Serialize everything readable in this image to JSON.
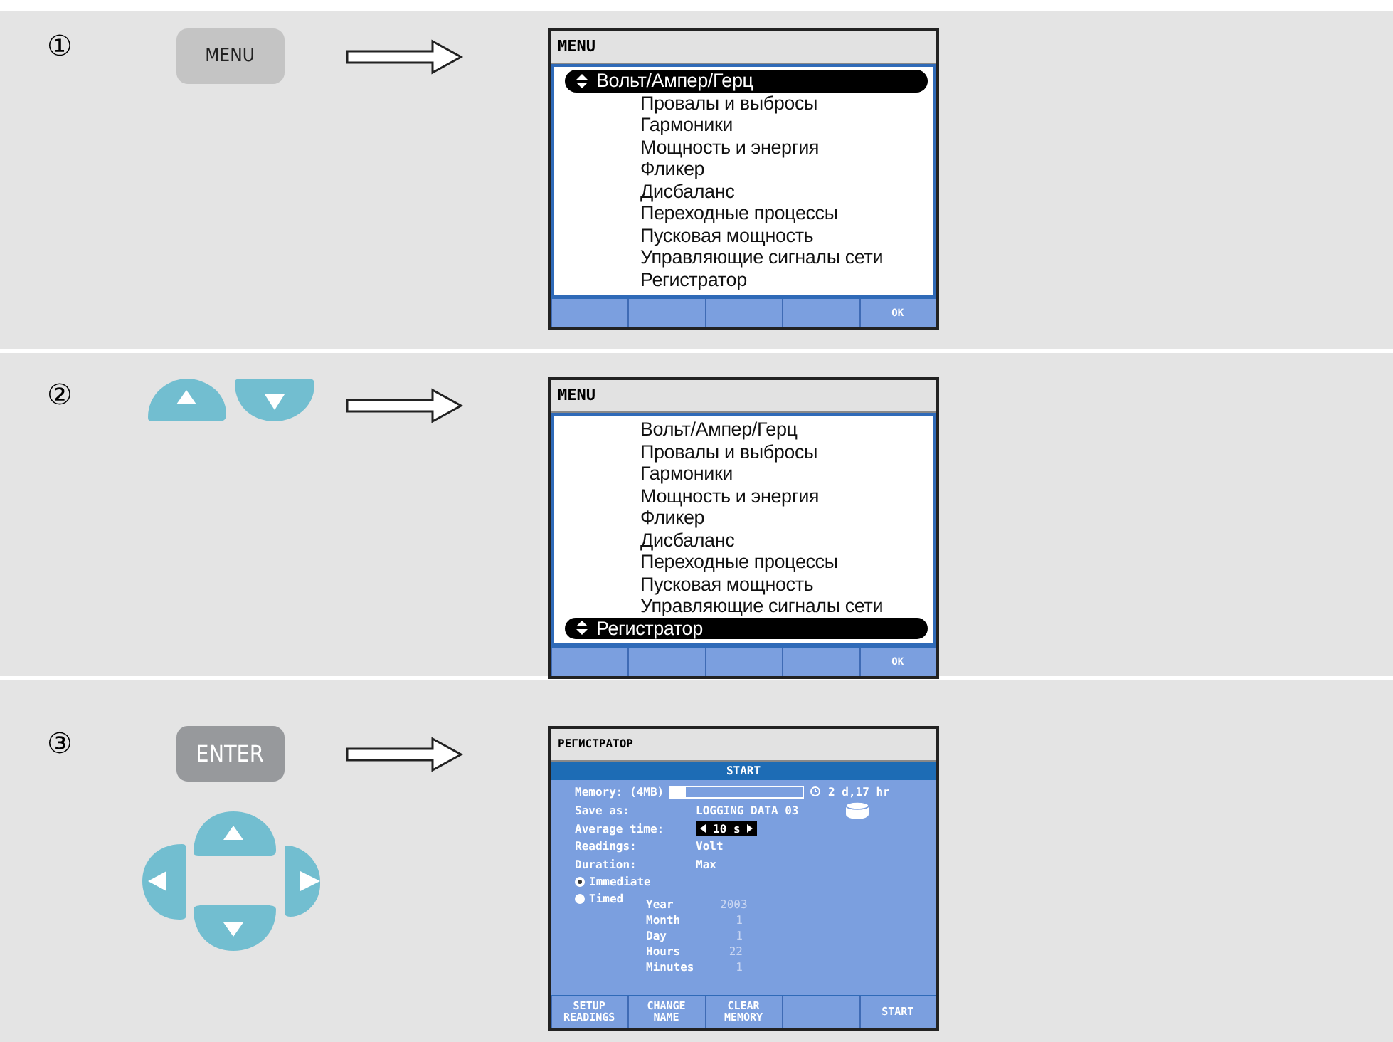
{
  "steps": [
    {
      "number": "①",
      "keys": [
        {
          "kind": "menu",
          "label": "MENU"
        }
      ],
      "screen": {
        "kind": "menu",
        "title": "MENU",
        "items": [
          {
            "label": "Вольт/Ампер/Герц",
            "selected": true
          },
          {
            "label": "Провалы и выбросы",
            "selected": false
          },
          {
            "label": "Гармоники",
            "selected": false
          },
          {
            "label": "Мощность и энергия",
            "selected": false
          },
          {
            "label": "Фликер",
            "selected": false
          },
          {
            "label": "Дисбаланс",
            "selected": false
          },
          {
            "label": "Переходные процессы",
            "selected": false
          },
          {
            "label": "Пусковая мощность",
            "selected": false
          },
          {
            "label": "Управляющие сигналы сети",
            "selected": false
          },
          {
            "label": "Регистратор",
            "selected": false
          }
        ],
        "softkeys": [
          {
            "kind": "blank"
          },
          {
            "kind": "blank"
          },
          {
            "kind": "blank"
          },
          {
            "kind": "blank"
          },
          {
            "kind": "key",
            "label": "OK"
          }
        ]
      }
    },
    {
      "number": "②",
      "keys": [
        {
          "kind": "up"
        },
        {
          "kind": "down"
        }
      ],
      "screen": {
        "kind": "menu",
        "title": "MENU",
        "items": [
          {
            "label": "Вольт/Ампер/Герц",
            "selected": false
          },
          {
            "label": "Провалы и выбросы",
            "selected": false
          },
          {
            "label": "Гармоники",
            "selected": false
          },
          {
            "label": "Мощность и энергия",
            "selected": false
          },
          {
            "label": "Фликер",
            "selected": false
          },
          {
            "label": "Дисбаланс",
            "selected": false
          },
          {
            "label": "Переходные процессы",
            "selected": false
          },
          {
            "label": "Пусковая мощность",
            "selected": false
          },
          {
            "label": "Управляющие сигналы сети",
            "selected": false
          },
          {
            "label": "Регистратор",
            "selected": true
          }
        ],
        "softkeys": [
          {
            "kind": "blank"
          },
          {
            "kind": "blank"
          },
          {
            "kind": "blank"
          },
          {
            "kind": "blank"
          },
          {
            "kind": "key",
            "label": "OK"
          }
        ]
      }
    },
    {
      "number": "③",
      "keys": [
        {
          "kind": "enter",
          "label": "ENTER"
        },
        {
          "kind": "dpad"
        }
      ],
      "screen": {
        "kind": "logger",
        "title": "РЕГИСТРАТОР",
        "header": "START",
        "memory": {
          "label": "Memory: (4MB)",
          "level": 0.12,
          "remaining": "2 d,17 hr"
        },
        "save_as": {
          "label": "Save as:",
          "value": "LOGGING DATA 03"
        },
        "average_time": {
          "label": "Average time:",
          "value": "10 s"
        },
        "readings": {
          "label": "Readings:",
          "value": "Volt"
        },
        "duration": {
          "label": "Duration:",
          "value": "Max"
        },
        "start_modes": [
          {
            "label": "Immediate",
            "selected": true
          },
          {
            "label": "Timed",
            "selected": false
          }
        ],
        "timed_fields": [
          {
            "label": "Year",
            "value": "2003"
          },
          {
            "label": "Month",
            "value": "1"
          },
          {
            "label": "Day",
            "value": "1"
          },
          {
            "label": "Hours",
            "value": "22"
          },
          {
            "label": "Minutes",
            "value": "1"
          }
        ],
        "softkeys": [
          {
            "kind": "key",
            "label": "SETUP READINGS"
          },
          {
            "kind": "key",
            "label": "CHANGE NAME"
          },
          {
            "kind": "key",
            "label": "CLEAR MEMORY"
          },
          {
            "kind": "blank"
          },
          {
            "kind": "key",
            "label": "START"
          }
        ]
      }
    }
  ]
}
